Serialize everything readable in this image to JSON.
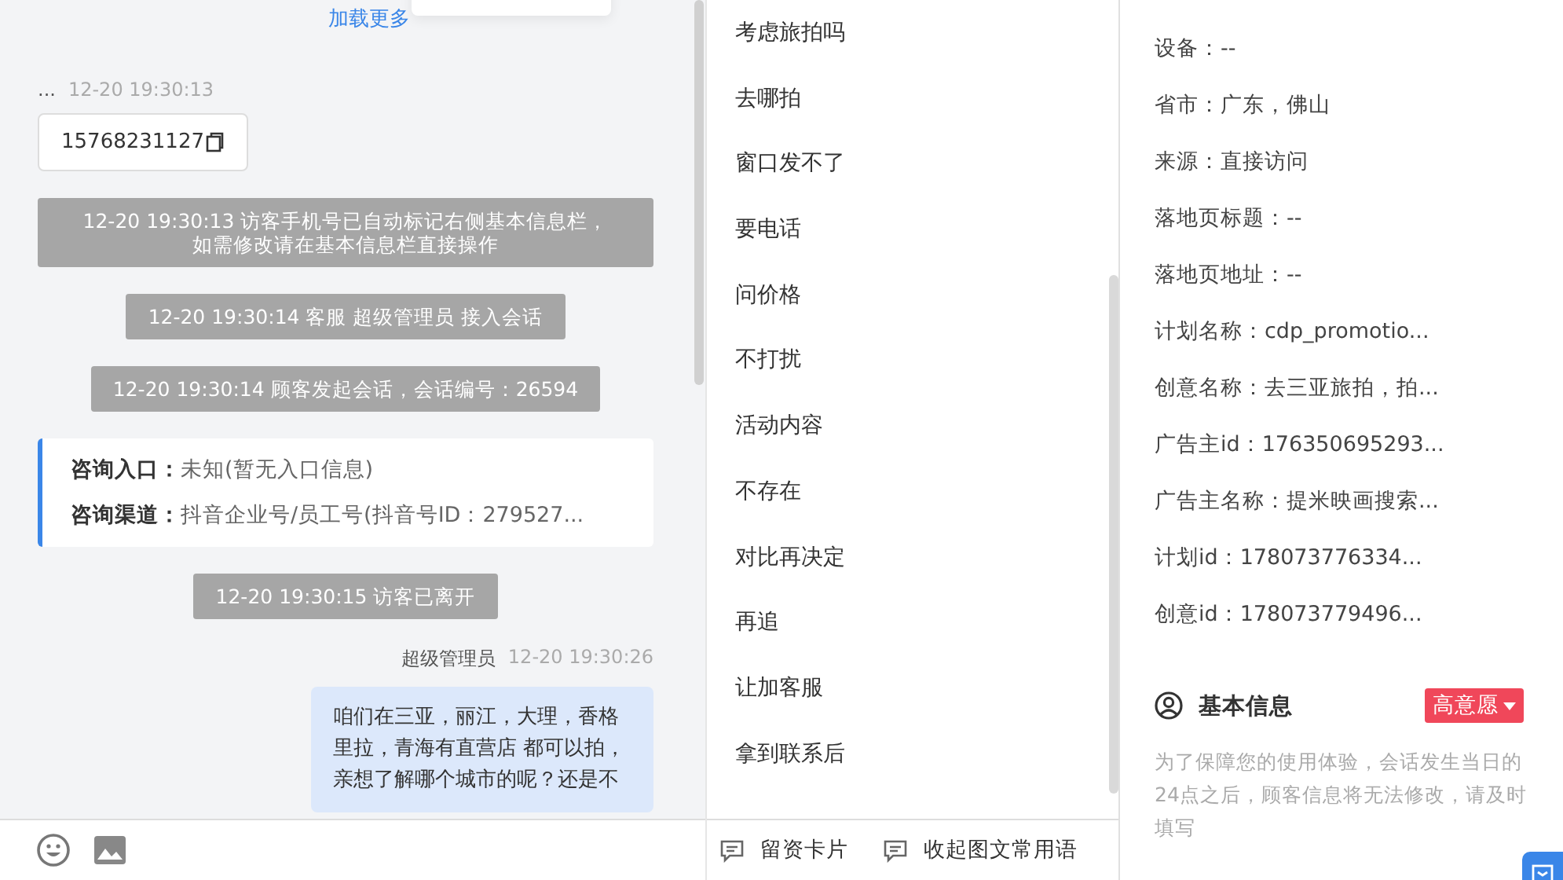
{
  "load_more": "加载更多",
  "messages": [
    {
      "kind": "phone",
      "sender": "...",
      "time": "12-20 19:30:13",
      "text": "15768231127"
    },
    {
      "kind": "notice",
      "text": "12-20 19:30:13 访客手机号已自动标记右侧基本信息栏，如需修改请在基本信息栏直接操作"
    },
    {
      "kind": "notice",
      "text": "12-20 19:30:14 客服 超级管理员 接入会话"
    },
    {
      "kind": "notice",
      "text": "12-20 19:30:14 顾客发起会话，会话编号：26594"
    },
    {
      "kind": "entry_card",
      "rows": [
        {
          "label": "咨询入口：",
          "value": "未知(暂无入口信息)"
        },
        {
          "label": "咨询渠道：",
          "value": "抖音企业号/员工号(抖音号ID：279527..."
        }
      ]
    },
    {
      "kind": "notice",
      "text": "12-20 19:30:15 访客已离开"
    },
    {
      "kind": "agent",
      "sender": "超级管理员",
      "time": "12-20 19:30:26",
      "text": "咱们在三亚，丽江，大理，香格里拉，青海有直营店 都可以拍，亲想了解哪个城市的呢？还是不"
    }
  ],
  "quick_phrases": [
    "考虑旅拍吗",
    "去哪拍",
    "窗口发不了",
    "要电话",
    "问价格",
    "不打扰",
    "活动内容",
    "不存在",
    "对比再决定",
    "再追",
    "让加客服",
    "拿到联系后"
  ],
  "bottom_actions": [
    "留资卡片",
    "收起图文常用语"
  ],
  "visitor_fields": [
    "设备：--",
    "省市：广东，佛山",
    "来源：直接访问",
    "落地页标题：--",
    "落地页地址：--",
    "计划名称：cdp_promotio...",
    "创意名称：去三亚旅拍，拍...",
    "广告主id：176350695293...",
    "广告主名称：提米映画搜索...",
    "计划id：178073776334...",
    "创意id：178073779496..."
  ],
  "basic_info": {
    "title": "基本信息",
    "tag": "高意愿",
    "hint": "为了保障您的使用体验，会话发生当日的24点之后，顾客信息将无法修改，请及时填写"
  }
}
